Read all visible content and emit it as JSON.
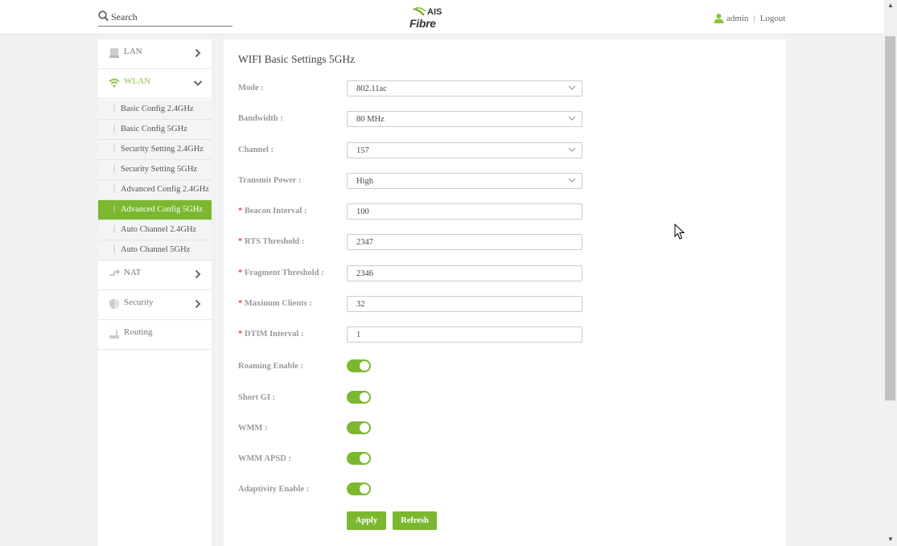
{
  "header": {
    "search_placeholder": "Search",
    "logo_top": "AIS",
    "logo_bottom": "Fibre",
    "user": "admin",
    "separator": "|",
    "logout": "Logout"
  },
  "sidebar": {
    "items": [
      {
        "label": "LAN",
        "icon": "lan-icon"
      },
      {
        "label": "WLAN",
        "icon": "wifi-icon"
      },
      {
        "label": "NAT",
        "icon": "nat-icon"
      },
      {
        "label": "Security",
        "icon": "shield-icon"
      },
      {
        "label": "Routing",
        "icon": "routing-icon"
      }
    ],
    "sub_items": [
      "Basic Config 2.4GHz",
      "Basic Config 5GHz",
      "Security Setting 2.4GHz",
      "Security Setting 5GHz",
      "Advanced Config 2.4GHz",
      "Advanced Config 5GHz",
      "Auto Channel 2.4GHz",
      "Auto Channel 5GHz"
    ],
    "sub_separator": "|",
    "active_sub": "Advanced Config 5GHz"
  },
  "main": {
    "title": "WIFI Basic Settings 5GHz",
    "required_mark": "*",
    "fields": {
      "mode": {
        "label": "Mode :",
        "value": "802.11ac"
      },
      "bandwidth": {
        "label": "Bandwidth :",
        "value": "80 MHz"
      },
      "channel": {
        "label": "Channel :",
        "value": "157"
      },
      "transmit_power": {
        "label": "Transmit Power :",
        "value": "High"
      },
      "beacon_interval": {
        "label": "Beacon Interval :",
        "value": "100"
      },
      "rts_threshold": {
        "label": "RTS Threshold :",
        "value": "2347"
      },
      "fragment_threshold": {
        "label": "Fragment Threshold :",
        "value": "2346"
      },
      "maximum_clients": {
        "label": "Maxinum Clients :",
        "value": "32"
      },
      "dtim_interval": {
        "label": "DTIM Interval :",
        "value": "1"
      }
    },
    "toggles": {
      "roaming": {
        "label": "Roaming Enable :",
        "on": true
      },
      "short_gi": {
        "label": "Short GI :",
        "on": true
      },
      "wmm": {
        "label": "WMM :",
        "on": true
      },
      "wmm_apsd": {
        "label": "WMM APSD :",
        "on": true
      },
      "adaptivity": {
        "label": "Adaptivity Enable :",
        "on": true
      }
    },
    "apply_label": "Apply",
    "refresh_label": "Refresh"
  },
  "colors": {
    "accent": "#7cb82f",
    "required": "#e74c3c"
  }
}
